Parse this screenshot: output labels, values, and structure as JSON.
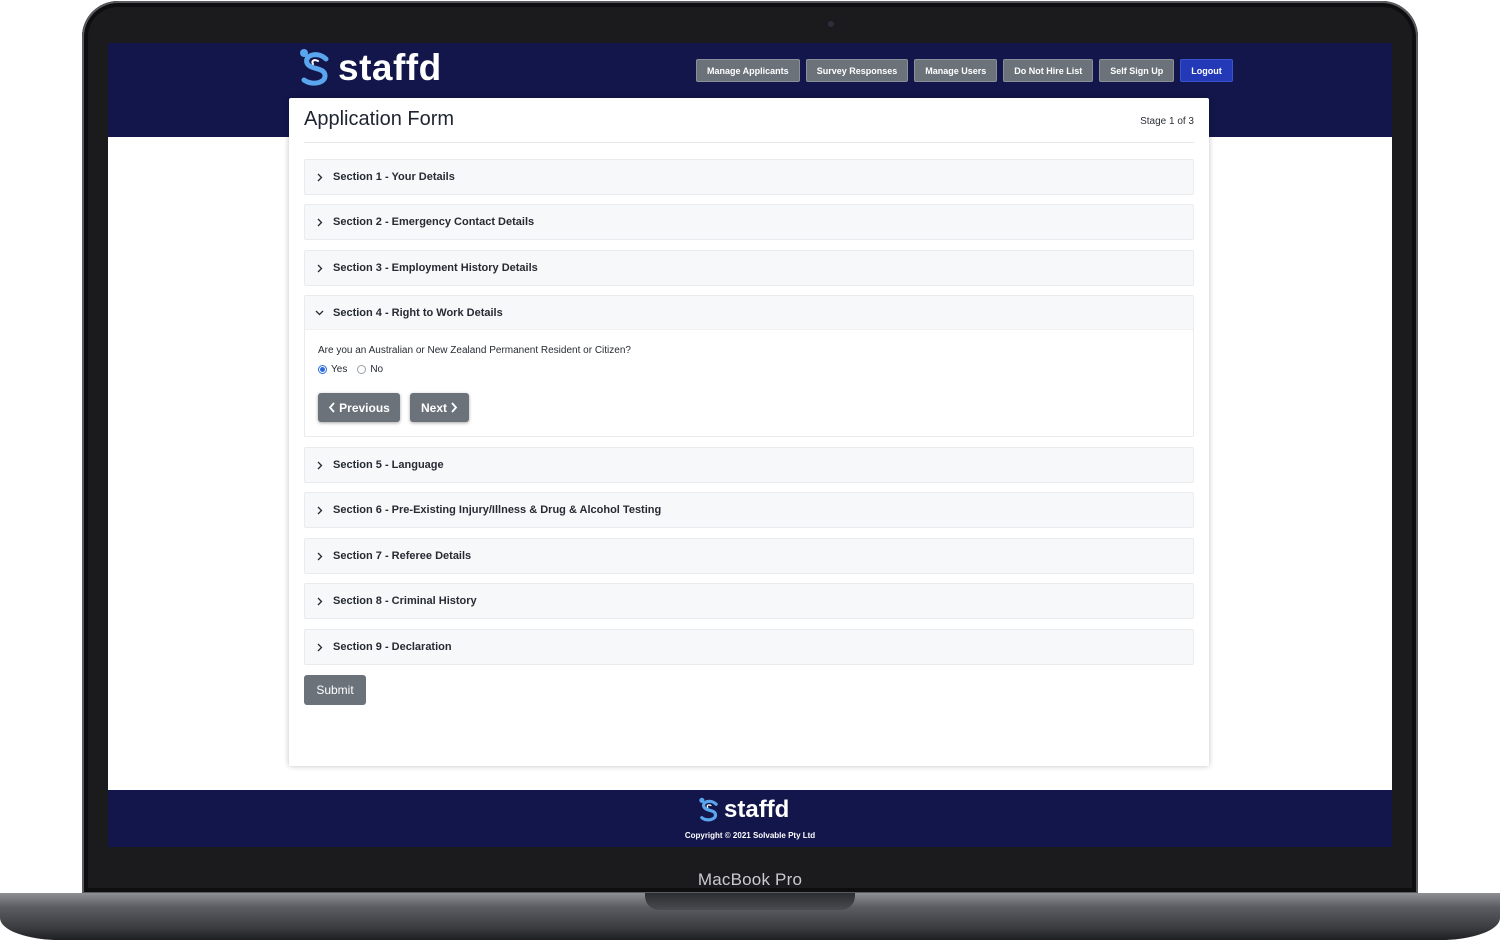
{
  "device": {
    "label": "MacBook Pro"
  },
  "header": {
    "logo_text": "staffd",
    "nav": [
      "Manage Applicants",
      "Survey Responses",
      "Manage Users",
      "Do Not Hire List",
      "Self Sign Up",
      "Logout"
    ]
  },
  "form": {
    "title": "Application Form",
    "stage": "Stage 1 of 3",
    "sections": [
      "Section 1 - Your Details",
      "Section 2 - Emergency Contact Details",
      "Section 3 - Employment History Details",
      "Section 4 - Right to Work Details",
      "Section 5 - Language",
      "Section 6 - Pre-Existing Injury/Illness & Drug & Alcohol Testing",
      "Section 7 - Referee Details",
      "Section 8 - Criminal History",
      "Section 9 - Declaration"
    ],
    "open_section": {
      "question": "Are you an Australian or New Zealand Permanent Resident or Citizen?",
      "options": [
        "Yes",
        "No"
      ],
      "selected": "Yes",
      "previous_label": "Previous",
      "next_label": "Next"
    },
    "submit_label": "Submit"
  },
  "footer": {
    "logo_text": "staffd",
    "copyright": "Copyright © 2021 Solvable Pty Ltd"
  },
  "colors": {
    "navy": "#12164a",
    "button_gray": "#6b727a",
    "logout_blue": "#2339b8",
    "logo_blue": "#5aa6ee"
  }
}
